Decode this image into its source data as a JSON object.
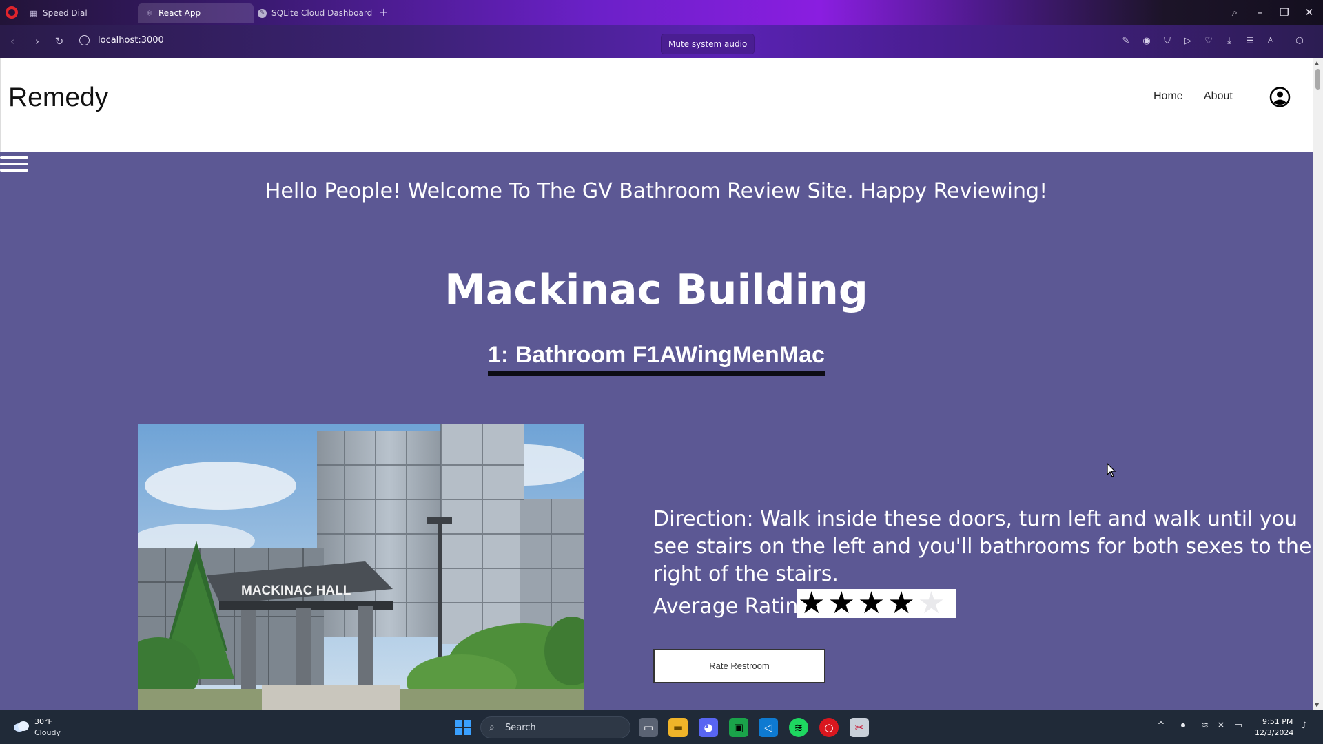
{
  "browser": {
    "tabs": [
      {
        "label": "Speed Dial",
        "icon": "grid-icon",
        "active": false
      },
      {
        "label": "React App",
        "icon": "react-icon",
        "active": true
      },
      {
        "label": "SQLite Cloud Dashboard",
        "icon": "sqlite-icon",
        "active": false
      }
    ],
    "url": "localhost:3000",
    "tooltip": "Mute system audio"
  },
  "site": {
    "brand": "Remedy",
    "nav": {
      "home": "Home",
      "about": "About"
    },
    "welcome": "Hello People! Welcome To The GV Bathroom Review Site. Happy Reviewing!",
    "building_name": "Mackinac Building",
    "bathroom_title": "1: Bathroom F1AWingMenMac",
    "photo_sign": "MACKINAC HALL",
    "direction": "Direction: Walk inside these doors, turn left and walk until you see stairs on the left and you'll bathrooms for both sexes to the right of the stairs.",
    "average_rating_label": "Average Rating:",
    "rating": {
      "value": 4,
      "max": 5
    },
    "rate_button": "Rate Restroom"
  },
  "taskbar": {
    "weather_temp": "30°F",
    "weather_desc": "Cloudy",
    "search_placeholder": "Search",
    "time": "9:51 PM",
    "date": "12/3/2024"
  },
  "colors": {
    "page_background": "#5c5894",
    "underline": "#0c0c14",
    "accent_purple": "#8a1ee0"
  }
}
